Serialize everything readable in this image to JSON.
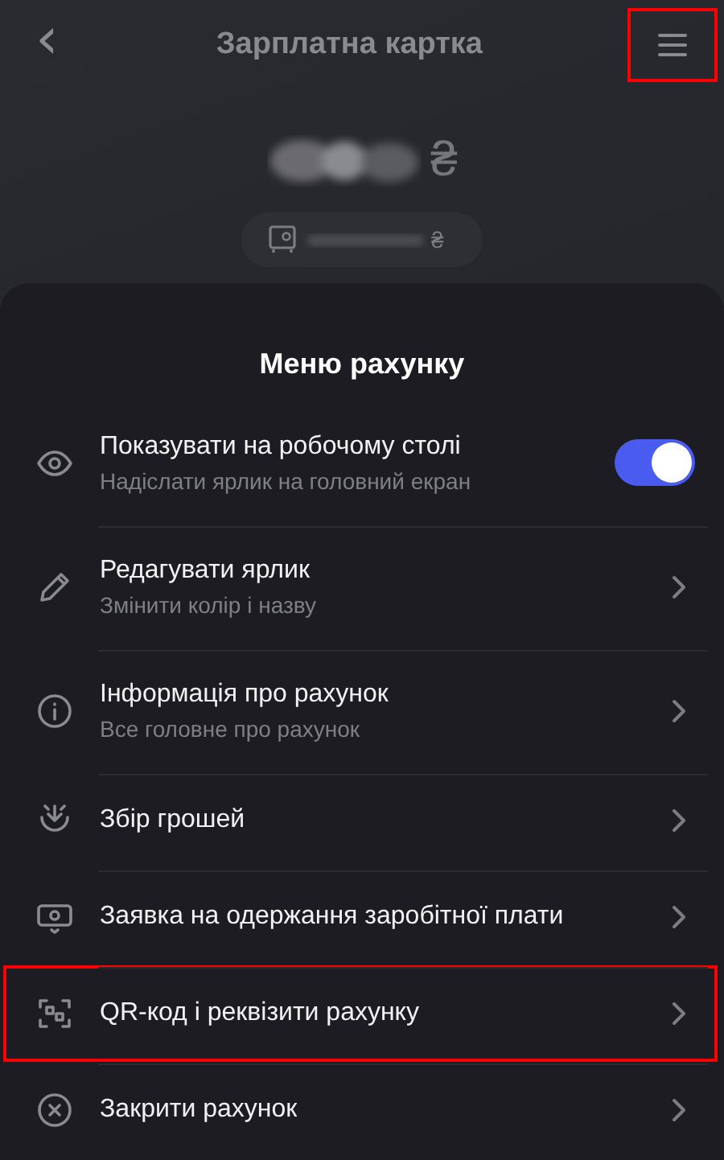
{
  "header": {
    "title": "Зарплатна картка",
    "back_button": "‹",
    "menu_button": {
      "highlighted": true
    }
  },
  "balance": {
    "currency": "₴"
  },
  "savings_pill": {
    "currency": "₴"
  },
  "menu": {
    "title": "Меню рахунку",
    "items": [
      {
        "kind": "toggle",
        "title": "Показувати на робочому столі",
        "subtitle": "Надіслати ярлик на головний екран",
        "on": true,
        "highlighted": false
      },
      {
        "kind": "link",
        "title": "Редагувати ярлик",
        "subtitle": "Змінити колір і назву",
        "highlighted": false
      },
      {
        "kind": "link",
        "title": "Інформація про рахунок",
        "subtitle": "Все головне про рахунок",
        "highlighted": false
      },
      {
        "kind": "link",
        "title": "Збір грошей",
        "highlighted": false
      },
      {
        "kind": "link",
        "title": "Заявка на одержання заробітної плати",
        "highlighted": false
      },
      {
        "kind": "link",
        "title": "QR-код і реквізити рахунку",
        "highlighted": true
      },
      {
        "kind": "link",
        "title": "Закрити рахунок",
        "highlighted": false
      }
    ]
  }
}
